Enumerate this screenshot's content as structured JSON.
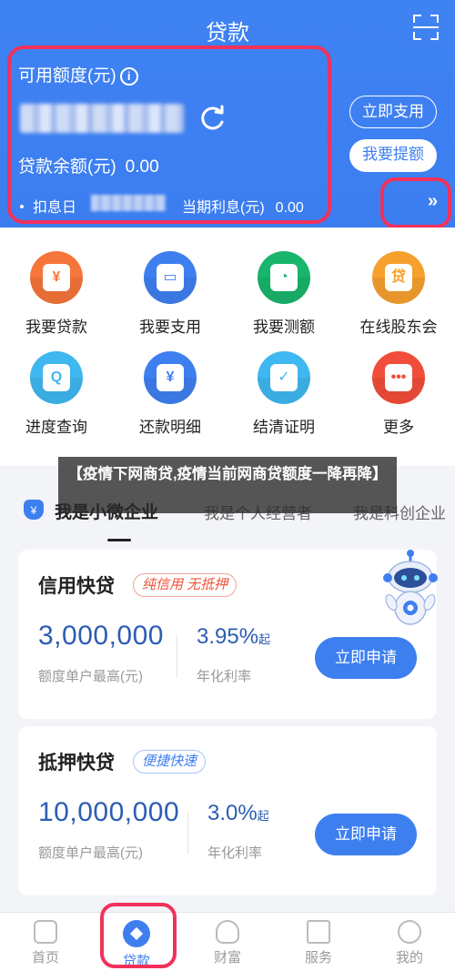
{
  "header": {
    "title": "贷款",
    "credit_label": "可用额度(元)",
    "info_glyph": "i",
    "balance_label": "贷款余额(元)",
    "balance_value": "0.00",
    "due_label": "扣息日",
    "interest_label": "当期利息(元)",
    "interest_value": "0.00",
    "use_button": "立即支用",
    "withdraw_button": "我要提额",
    "more_arrow": "»"
  },
  "functions": [
    {
      "label": "我要贷款",
      "glyph": "¥",
      "color": "#f5753a"
    },
    {
      "label": "我要支用",
      "glyph": "▭",
      "color": "#3e7ff0"
    },
    {
      "label": "我要测额",
      "glyph": "◔",
      "color": "#18b56c"
    },
    {
      "label": "在线股东会",
      "glyph": "贷",
      "color": "#f7a02e"
    },
    {
      "label": "进度查询",
      "glyph": "Q",
      "color": "#3fb7f0"
    },
    {
      "label": "还款明细",
      "glyph": "¥",
      "color": "#3e7ff0"
    },
    {
      "label": "结清证明",
      "glyph": "✓",
      "color": "#3fb7f0"
    },
    {
      "label": "更多",
      "glyph": "•••",
      "color": "#f24d3a"
    }
  ],
  "overlay": {
    "text": "【疫情下网商贷,疫情当前网商贷额度一降再降】"
  },
  "tabs": {
    "icon_glyph": "¥",
    "items": [
      "我是小微企业",
      "我是个人经营者",
      "我是科创企业"
    ]
  },
  "cards": [
    {
      "title": "信用快贷",
      "tag": "纯信用 无抵押",
      "amount": "3,000,000",
      "amount_label": "额度单户最高(元)",
      "rate": "3.95%",
      "rate_suffix": "起",
      "rate_label": "年化利率",
      "apply": "立即申请"
    },
    {
      "title": "抵押快贷",
      "tag": "便捷快速",
      "amount": "10,000,000",
      "amount_label": "额度单户最高(元)",
      "rate": "3.0%",
      "rate_suffix": "起",
      "rate_label": "年化利率",
      "apply": "立即申请"
    }
  ],
  "bottom_nav": [
    "首页",
    "贷款",
    "财富",
    "服务",
    "我的"
  ]
}
